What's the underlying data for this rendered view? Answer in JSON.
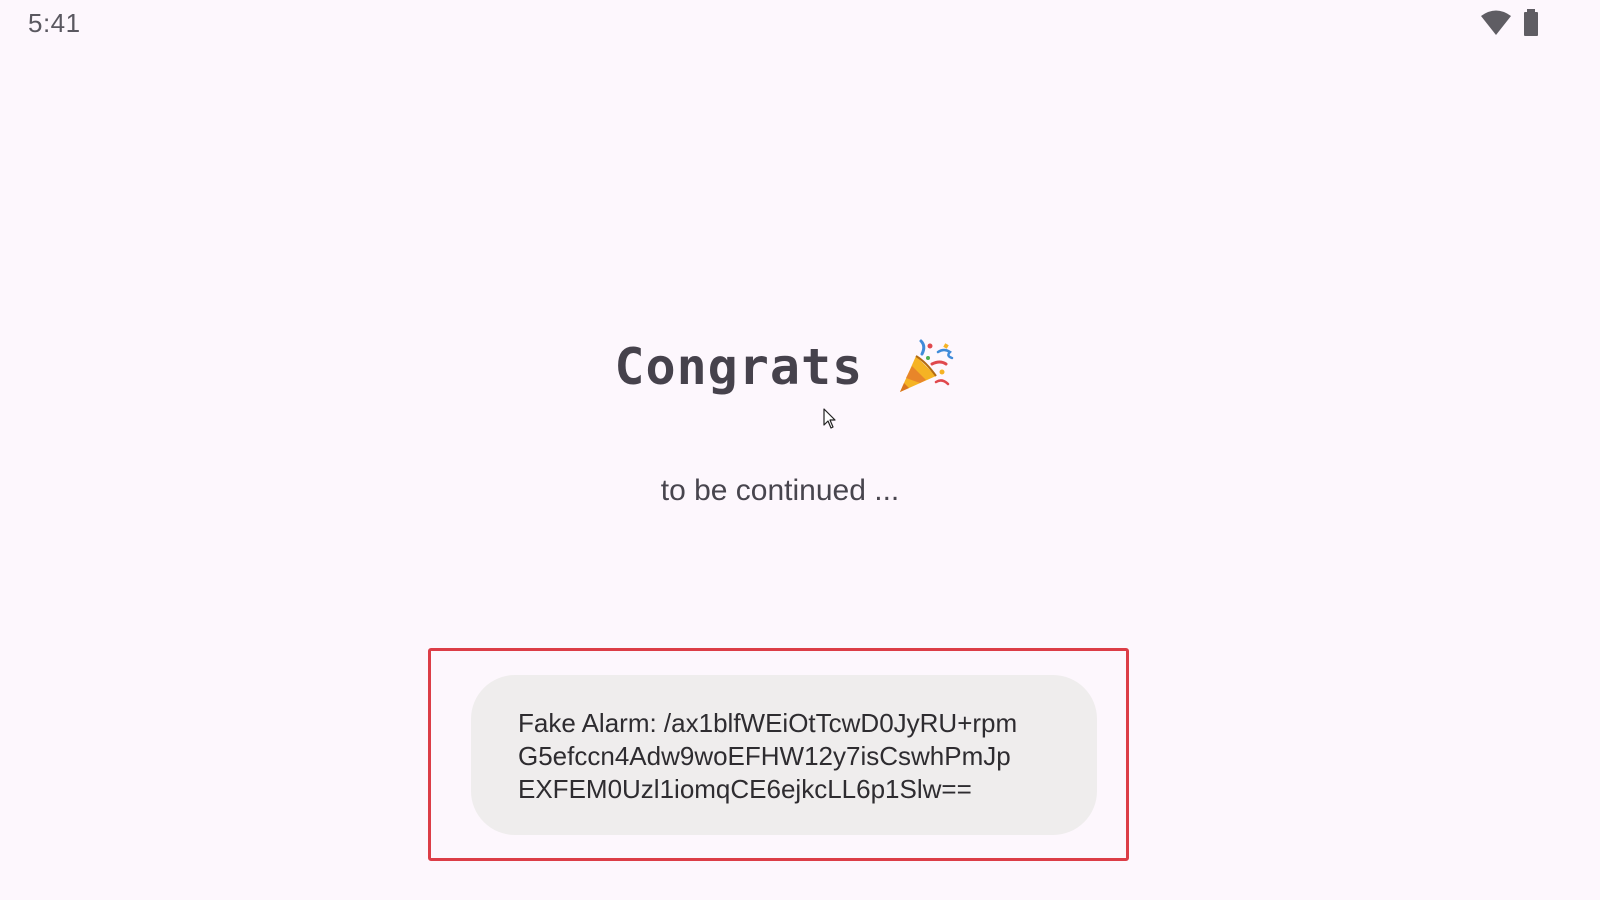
{
  "status_bar": {
    "time": "5:41",
    "icons": [
      "wifi-icon",
      "battery-icon"
    ]
  },
  "main": {
    "title": "Congrats",
    "title_icon": "party-popper-icon",
    "subtitle": "to be continued ..."
  },
  "toast": {
    "lines": [
      "Fake Alarm: /ax1blfWEiOtTcwD0JyRU+rpm",
      "G5efccn4Adw9woEFHW12y7isCswhPmJp",
      "EXFEM0Uzl1iomqCE6ejkcLL6p1Slw=="
    ]
  },
  "colors": {
    "background": "#fdf7fd",
    "toast_background": "#efeded",
    "highlight_border": "#dc3d47"
  }
}
